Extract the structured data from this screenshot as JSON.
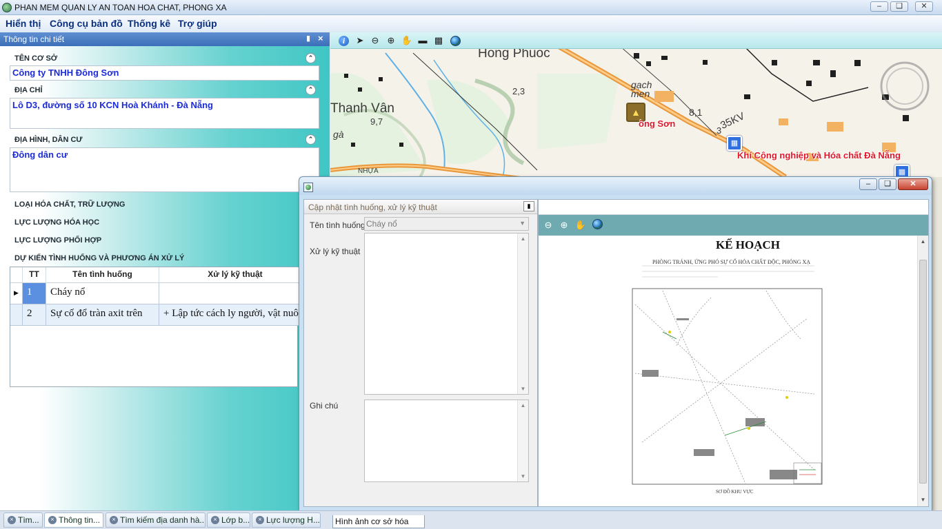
{
  "window": {
    "title": "PHAN MEM QUAN LY AN TOAN HOA CHAT, PHONG XA"
  },
  "menu": {
    "items": [
      "Hiển thị",
      "Công cụ bản đồ",
      "Thống kê",
      "Trợ giúp"
    ]
  },
  "left_panel": {
    "header": "Thông tin chi tiết",
    "sections": {
      "facility": {
        "label": "TÊN CƠ SỞ",
        "value": "Công ty TNHH Đông Sơn"
      },
      "address": {
        "label": "ĐỊA CHỈ",
        "value": "Lô D3, đường số 10 KCN Hoà Khánh - Đà Nẵng"
      },
      "terrain": {
        "label": "ĐỊA HÌNH, DÂN CƯ",
        "value": "Đông dân cư"
      },
      "chemicals": {
        "label": "LOẠI HÓA CHẤT, TRỮ LƯỢNG"
      },
      "chem_forces": {
        "label": "LỰC LƯỢNG HÓA HỌC"
      },
      "coop_forces": {
        "label": "LỰC LƯỢNG PHỐI HỢP"
      },
      "scenarios": {
        "label": "DỰ KIẾN TÌNH HUỐNG VÀ PHƯƠNG ÁN XỬ LÝ"
      }
    },
    "grid": {
      "columns": [
        "TT",
        "Tên tình huống",
        "Xử lý kỹ thuật"
      ],
      "rows": [
        {
          "tt": "1",
          "name": "Cháy nổ",
          "treatment": ""
        },
        {
          "tt": "2",
          "name": "Sự cố đổ tràn axit trên",
          "treatment": "+ Lập tức cách ly người, vật nuôi"
        }
      ]
    }
  },
  "map": {
    "labels": {
      "hong_phuoc": "Hong Phuoc",
      "thanh_van": "Thanh Vân",
      "gach_men": "gạch\nmen",
      "n97": "9,7",
      "n23": "2,3",
      "n81": "8,1",
      "kv": "35KV",
      "ga": "gà",
      "nhua": "NHỰA",
      "n3": "3"
    },
    "markers": {
      "dong_son": "ông Sơn",
      "kcn": "Khí Công nghiệp và Hóa chất Đà Nẵng"
    }
  },
  "dialog": {
    "panel_title": "Cập nhật tình huống, xử lý kỹ thuật",
    "fields": {
      "scenario_label": "Tên tình huống",
      "scenario_value": "Cháy nổ",
      "treatment_label": "Xử lý kỹ thuật",
      "notes_label": "Ghi chú"
    },
    "document": {
      "title": "KẾ HOẠCH",
      "subtitle": "PHÒNG TRÁNH, ỨNG PHÓ SỰ CỐ HÓA CHẤT ĐỘC, PHÓNG XẠ",
      "caption": "SƠ ĐỒ KHU VỰC"
    }
  },
  "bottom_tabs": [
    "Tìm...",
    "Thông tin...",
    "Tìm kiếm địa danh hà...",
    "Lớp b...",
    "Lực lượng H..."
  ],
  "map_tab": "Hình ảnh cơ sở hóa chất",
  "colors": {
    "panel_teal": "#3fc6c4",
    "header_blue": "#3c6fb9",
    "value_blue": "#1b2bd8",
    "map_red": "#e0182a"
  }
}
